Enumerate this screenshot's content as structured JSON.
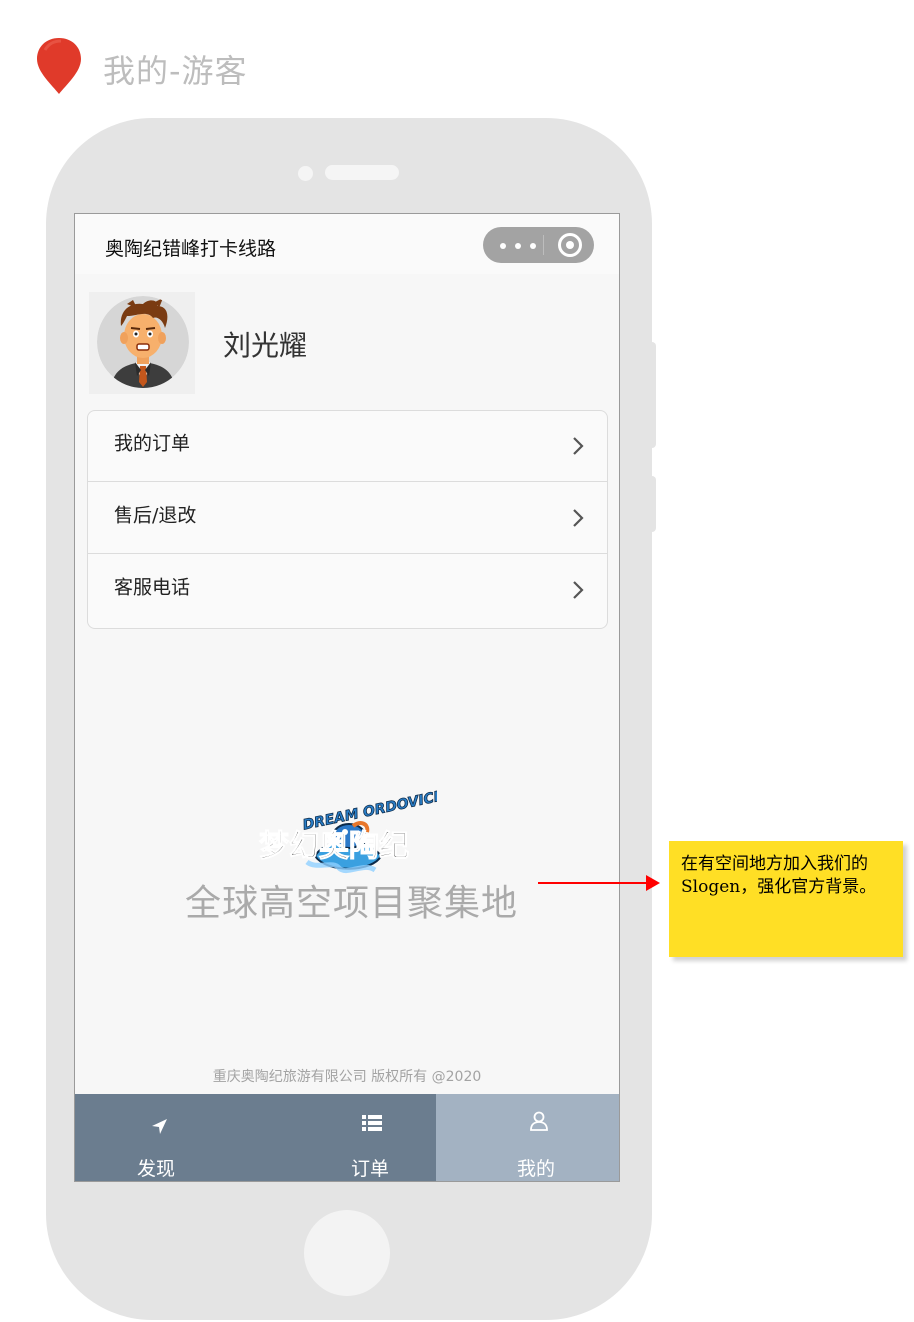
{
  "page_title": "我的-游客",
  "app": {
    "nav_title": "奥陶纪错峰打卡线路",
    "capsule_icons": [
      "more-dots-icon",
      "close-target-icon"
    ]
  },
  "profile": {
    "avatar": "cartoon-businessman-avatar",
    "name": "刘光耀"
  },
  "menu": {
    "items": [
      {
        "label": "我的订单",
        "icon": "chevron-right-icon"
      },
      {
        "label": "售后/退改",
        "icon": "chevron-right-icon"
      },
      {
        "label": "客服电话",
        "icon": "chevron-right-icon"
      }
    ]
  },
  "brand": {
    "logo_english": "DREAM ORDOVICIAN",
    "logo_chinese": "梦幻奥陶纪",
    "slogan": "全球高空项目聚集地",
    "copyright": "重庆奥陶纪旅游有限公司 版权所有 @2020"
  },
  "tabbar": {
    "tabs": [
      {
        "label": "发现",
        "icon": "navigation-arrow-icon",
        "active": false
      },
      {
        "label": "订单",
        "icon": "list-icon",
        "active": false
      },
      {
        "label": "我的",
        "icon": "user-icon",
        "active": true
      }
    ]
  },
  "annotation": {
    "text": "在有空间地方加入我们的Slogen，强化官方背景。",
    "color": "#ffdf25",
    "arrow_color": "#ff0000"
  },
  "colors": {
    "tabbar": "#6b7d8f",
    "tabbar_active": "#a3b2c2",
    "pin": "#e03a2a",
    "phone_frame": "#e4e4e4"
  }
}
